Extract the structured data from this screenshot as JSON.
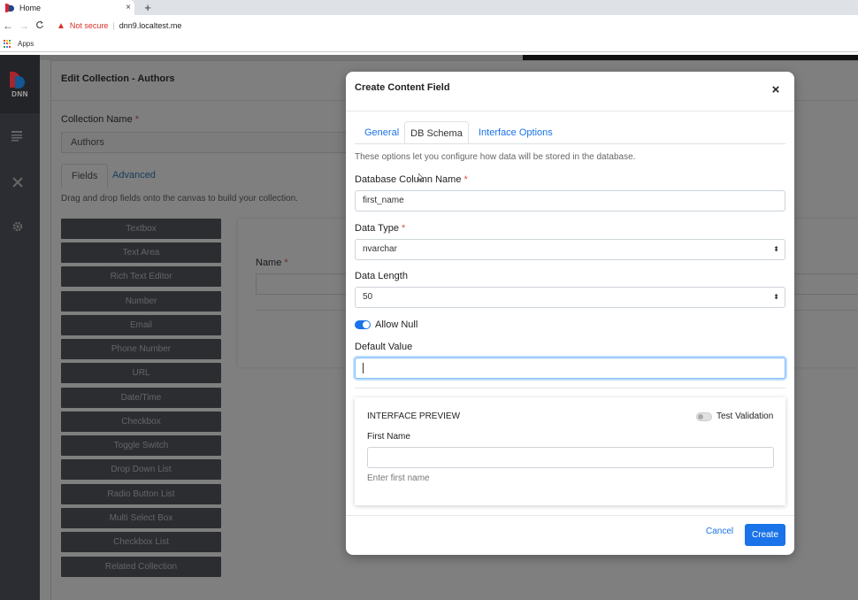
{
  "browser": {
    "tab_title": "Home",
    "tab_close": "×",
    "new_tab": "+",
    "not_secure": "Not secure",
    "url": "dnn9.localtest.me",
    "bookmarks_apps": "Apps",
    "nav_back": "←",
    "nav_forward": "→",
    "nav_reload": "C"
  },
  "sidebar": {
    "logo_text": "DNN",
    "icons": [
      "content-icon",
      "tools-icon",
      "settings-icon"
    ]
  },
  "page": {
    "title": "Edit Collection - Authors",
    "collection_name_label": "Collection Name",
    "required_mark": "*",
    "collection_name_value": "Authors",
    "tabs": [
      "Fields",
      "Advanced"
    ],
    "help_text": "Drag and drop fields onto the canvas to build your collection.",
    "field_types": [
      "Textbox",
      "Text Area",
      "Rich Text Editor",
      "Number",
      "Email",
      "Phone Number",
      "URL",
      "Date/Time",
      "Checkbox",
      "Toggle Switch",
      "Drop Down List",
      "Radio Button List",
      "Multi Select Box",
      "Checkbox List",
      "Related Collection"
    ],
    "canvas_name_label": "Name"
  },
  "modal": {
    "title": "Create Content Field",
    "close": "×",
    "tabs": {
      "general": "General",
      "db_schema": "DB Schema",
      "interface": "Interface Options"
    },
    "description": "These options let you configure how data will be stored in the database.",
    "column_name_label": "Database Column Name",
    "column_name_value": "first_name",
    "data_type_label": "Data Type",
    "data_type_value": "nvarchar",
    "data_length_label": "Data Length",
    "data_length_value": "50",
    "select_arrows": "⬍",
    "allow_null_label": "Allow Null",
    "allow_null": true,
    "default_value_label": "Default Value",
    "default_value": "",
    "preview": {
      "title": "INTERFACE PREVIEW",
      "test_validation": "Test Validation",
      "field_label": "First Name",
      "help": "Enter first name"
    },
    "cancel": "Cancel",
    "create": "Create"
  },
  "colors": {
    "accent": "#1a73e8",
    "sidebar_bg": "#3a3d43",
    "field_button_bg": "#575b61",
    "danger": "#d93025"
  }
}
